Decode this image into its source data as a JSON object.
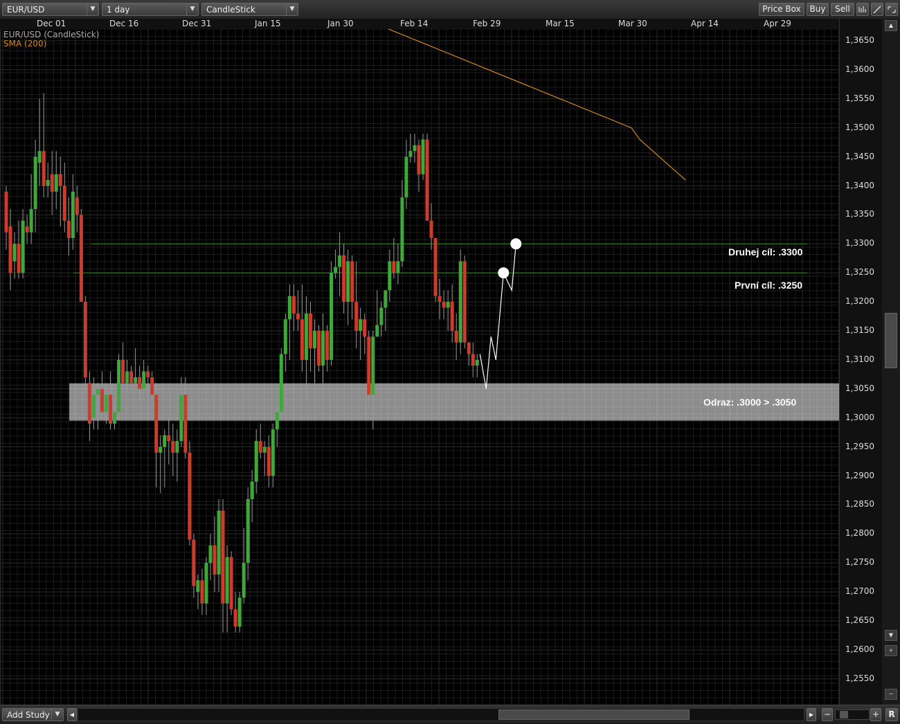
{
  "toolbar": {
    "symbol": "EUR/USD",
    "interval": "1 day",
    "chart_type": "CandleStick",
    "price_box": "Price Box",
    "buy": "Buy",
    "sell": "Sell"
  },
  "legend": {
    "series": "EUR/USD (CandleStick)",
    "indicator": "SMA (200)"
  },
  "time_axis": [
    "Dec 01",
    "Dec 16",
    "Dec 31",
    "Jan 15",
    "Jan 30",
    "Feb 14",
    "Feb 29",
    "Mar 15",
    "Mar 30",
    "Apr 14",
    "Apr 29"
  ],
  "price_axis": [
    "1,3650",
    "1,3600",
    "1,3550",
    "1,3500",
    "1,3450",
    "1,3400",
    "1,3350",
    "1,3300",
    "1,3250",
    "1,3200",
    "1,3150",
    "1,3100",
    "1,3050",
    "1,3000",
    "1,2950",
    "1,2900",
    "1,2850",
    "1,2800",
    "1,2750",
    "1,2700",
    "1,2650",
    "1,2600",
    "1,2550"
  ],
  "annotations": {
    "target2": "Druhej cíl: .3300",
    "target1": "První cíl: .3250",
    "bounce": "Odraz: .3000 > .3050"
  },
  "statusbar": {
    "add_study": "Add Study",
    "reset": "R"
  },
  "colors": {
    "up": "#3fa83a",
    "down": "#d03a2a",
    "sma": "#d08a20",
    "target_line": "#2e7d1e"
  },
  "chart_data": {
    "type": "candlestick",
    "symbol": "EUR/USD",
    "ylim": [
      1.252,
      1.369
    ],
    "candles": [
      [
        1.339,
        1.34,
        1.329,
        1.332
      ],
      [
        1.333,
        1.336,
        1.322,
        1.325
      ],
      [
        1.327,
        1.332,
        1.324,
        1.33
      ],
      [
        1.33,
        1.334,
        1.324,
        1.325
      ],
      [
        1.325,
        1.336,
        1.324,
        1.334
      ],
      [
        1.333,
        1.335,
        1.33,
        1.332
      ],
      [
        1.332,
        1.342,
        1.33,
        1.336
      ],
      [
        1.336,
        1.348,
        1.332,
        1.345
      ],
      [
        1.344,
        1.355,
        1.34,
        1.346
      ],
      [
        1.346,
        1.356,
        1.338,
        1.34
      ],
      [
        1.34,
        1.344,
        1.338,
        1.341
      ],
      [
        1.342,
        1.346,
        1.335,
        1.339
      ],
      [
        1.339,
        1.346,
        1.336,
        1.342
      ],
      [
        1.342,
        1.345,
        1.333,
        1.34
      ],
      [
        1.34,
        1.344,
        1.332,
        1.334
      ],
      [
        1.334,
        1.338,
        1.328,
        1.331
      ],
      [
        1.331,
        1.342,
        1.329,
        1.339
      ],
      [
        1.338,
        1.34,
        1.332,
        1.335
      ],
      [
        1.335,
        1.336,
        1.32,
        1.32
      ],
      [
        1.32,
        1.321,
        1.304,
        1.307
      ],
      [
        1.306,
        1.308,
        1.296,
        1.299
      ],
      [
        1.3,
        1.307,
        1.298,
        1.304
      ],
      [
        1.304,
        1.306,
        1.298,
        1.305
      ],
      [
        1.305,
        1.308,
        1.3,
        1.301
      ],
      [
        1.301,
        1.306,
        1.299,
        1.304
      ],
      [
        1.304,
        1.308,
        1.298,
        1.299
      ],
      [
        1.299,
        1.303,
        1.298,
        1.301
      ],
      [
        1.301,
        1.311,
        1.3,
        1.31
      ],
      [
        1.31,
        1.313,
        1.305,
        1.306
      ],
      [
        1.306,
        1.31,
        1.304,
        1.308
      ],
      [
        1.308,
        1.309,
        1.305,
        1.306
      ],
      [
        1.306,
        1.312,
        1.305,
        1.307
      ],
      [
        1.307,
        1.309,
        1.303,
        1.305
      ],
      [
        1.305,
        1.31,
        1.304,
        1.308
      ],
      [
        1.308,
        1.309,
        1.306,
        1.307
      ],
      [
        1.307,
        1.308,
        1.302,
        1.304
      ],
      [
        1.304,
        1.306,
        1.288,
        1.294
      ],
      [
        1.294,
        1.297,
        1.287,
        1.295
      ],
      [
        1.295,
        1.298,
        1.288,
        1.297
      ],
      [
        1.297,
        1.3,
        1.292,
        1.296
      ],
      [
        1.296,
        1.299,
        1.29,
        1.294
      ],
      [
        1.294,
        1.298,
        1.289,
        1.296
      ],
      [
        1.296,
        1.307,
        1.295,
        1.304
      ],
      [
        1.304,
        1.307,
        1.293,
        1.294
      ],
      [
        1.294,
        1.296,
        1.278,
        1.279
      ],
      [
        1.279,
        1.28,
        1.269,
        1.271
      ],
      [
        1.27,
        1.273,
        1.267,
        1.272
      ],
      [
        1.272,
        1.274,
        1.266,
        1.268
      ],
      [
        1.268,
        1.276,
        1.266,
        1.275
      ],
      [
        1.275,
        1.28,
        1.272,
        1.278
      ],
      [
        1.278,
        1.283,
        1.27,
        1.273
      ],
      [
        1.273,
        1.286,
        1.27,
        1.284
      ],
      [
        1.284,
        1.286,
        1.263,
        1.268
      ],
      [
        1.268,
        1.278,
        1.263,
        1.276
      ],
      [
        1.276,
        1.277,
        1.266,
        1.267
      ],
      [
        1.267,
        1.27,
        1.263,
        1.264
      ],
      [
        1.264,
        1.27,
        1.263,
        1.269
      ],
      [
        1.269,
        1.281,
        1.268,
        1.275
      ],
      [
        1.275,
        1.288,
        1.272,
        1.286
      ],
      [
        1.286,
        1.291,
        1.282,
        1.289
      ],
      [
        1.289,
        1.298,
        1.287,
        1.296
      ],
      [
        1.296,
        1.299,
        1.293,
        1.294
      ],
      [
        1.294,
        1.296,
        1.29,
        1.295
      ],
      [
        1.295,
        1.297,
        1.288,
        1.29
      ],
      [
        1.29,
        1.299,
        1.288,
        1.298
      ],
      [
        1.298,
        1.302,
        1.295,
        1.301
      ],
      [
        1.301,
        1.312,
        1.3,
        1.311
      ],
      [
        1.311,
        1.318,
        1.308,
        1.317
      ],
      [
        1.317,
        1.323,
        1.31,
        1.321
      ],
      [
        1.321,
        1.323,
        1.315,
        1.318
      ],
      [
        1.318,
        1.322,
        1.315,
        1.317
      ],
      [
        1.317,
        1.323,
        1.308,
        1.31
      ],
      [
        1.31,
        1.321,
        1.303,
        1.318
      ],
      [
        1.318,
        1.32,
        1.308,
        1.312
      ],
      [
        1.312,
        1.317,
        1.306,
        1.315
      ],
      [
        1.315,
        1.316,
        1.308,
        1.309
      ],
      [
        1.309,
        1.318,
        1.303,
        1.315
      ],
      [
        1.315,
        1.316,
        1.308,
        1.31
      ],
      [
        1.31,
        1.327,
        1.309,
        1.325
      ],
      [
        1.325,
        1.329,
        1.324,
        1.326
      ],
      [
        1.326,
        1.332,
        1.321,
        1.328
      ],
      [
        1.328,
        1.33,
        1.318,
        1.32
      ],
      [
        1.32,
        1.329,
        1.316,
        1.327
      ],
      [
        1.327,
        1.328,
        1.317,
        1.32
      ],
      [
        1.32,
        1.327,
        1.312,
        1.315
      ],
      [
        1.315,
        1.319,
        1.31,
        1.317
      ],
      [
        1.317,
        1.318,
        1.311,
        1.314
      ],
      [
        1.314,
        1.315,
        1.302,
        1.304
      ],
      [
        1.304,
        1.315,
        1.298,
        1.314
      ],
      [
        1.314,
        1.322,
        1.314,
        1.316
      ],
      [
        1.316,
        1.32,
        1.314,
        1.319
      ],
      [
        1.319,
        1.321,
        1.315,
        1.322
      ],
      [
        1.322,
        1.329,
        1.32,
        1.327
      ],
      [
        1.327,
        1.331,
        1.324,
        1.325
      ],
      [
        1.325,
        1.33,
        1.323,
        1.327
      ],
      [
        1.327,
        1.341,
        1.326,
        1.338
      ],
      [
        1.338,
        1.348,
        1.336,
        1.345
      ],
      [
        1.345,
        1.349,
        1.344,
        1.346
      ],
      [
        1.346,
        1.349,
        1.344,
        1.347
      ],
      [
        1.347,
        1.348,
        1.339,
        1.342
      ],
      [
        1.342,
        1.349,
        1.341,
        1.348
      ],
      [
        1.348,
        1.349,
        1.334,
        1.334
      ],
      [
        1.334,
        1.337,
        1.329,
        1.331
      ],
      [
        1.331,
        1.331,
        1.32,
        1.321
      ],
      [
        1.321,
        1.324,
        1.317,
        1.32
      ],
      [
        1.32,
        1.322,
        1.317,
        1.319
      ],
      [
        1.319,
        1.322,
        1.315,
        1.32
      ],
      [
        1.32,
        1.323,
        1.313,
        1.315
      ],
      [
        1.315,
        1.318,
        1.31,
        1.313
      ],
      [
        1.313,
        1.329,
        1.311,
        1.327
      ],
      [
        1.327,
        1.328,
        1.312,
        1.313
      ],
      [
        1.313,
        1.313,
        1.309,
        1.311
      ],
      [
        1.311,
        1.313,
        1.307,
        1.309
      ],
      [
        1.309,
        1.311,
        1.307,
        1.31
      ]
    ],
    "sma_200": [
      [
        1.369,
        85
      ],
      [
        1.35,
        150
      ],
      [
        1.348,
        152
      ],
      [
        1.341,
        163
      ]
    ],
    "projection": [
      [
        1.311,
        0
      ],
      [
        1.305,
        1
      ],
      [
        1.314,
        2
      ],
      [
        1.31,
        3
      ],
      [
        1.325,
        4
      ],
      [
        1.322,
        5
      ],
      [
        1.33,
        6
      ]
    ],
    "levels": {
      "target1": 1.325,
      "target2": 1.33,
      "zone": [
        1.3,
        1.305
      ]
    }
  }
}
